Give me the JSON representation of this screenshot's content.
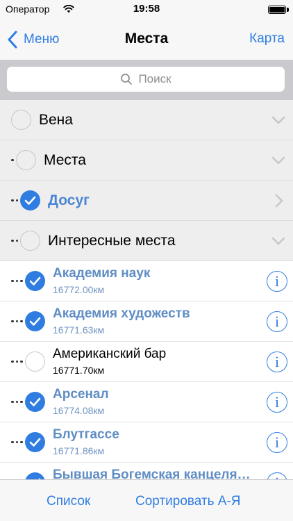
{
  "status_bar": {
    "carrier": "Оператор",
    "time": "19:58"
  },
  "nav": {
    "back_label": "Меню",
    "title": "Места",
    "right_label": "Карта"
  },
  "search": {
    "placeholder": "Поиск"
  },
  "groups": [
    {
      "label": "Вена",
      "level": 0,
      "checked": false,
      "expanded": true
    },
    {
      "label": "Места",
      "level": 1,
      "checked": false,
      "expanded": true
    },
    {
      "label": "Досуг",
      "level": 2,
      "checked": true,
      "expanded": false
    },
    {
      "label": "Интересные места",
      "level": 2,
      "checked": false,
      "expanded": true
    }
  ],
  "items": [
    {
      "title": "Академия наук",
      "distance": "16772.00км",
      "checked": true
    },
    {
      "title": "Академия художеств",
      "distance": "16771.63км",
      "checked": true
    },
    {
      "title": "Американский бар",
      "distance": "16771.70км",
      "checked": false
    },
    {
      "title": "Арсенал",
      "distance": "16774.08км",
      "checked": true
    },
    {
      "title": "Блутгассе",
      "distance": "16771.86км",
      "checked": true
    },
    {
      "title": "Бывшая Богемская канцеля…",
      "distance": "",
      "checked": true
    }
  ],
  "toolbar": {
    "list_label": "Список",
    "sort_label": "Сортировать А-Я"
  },
  "colors": {
    "accent": "#2f7de1",
    "selected_text": "#5f8dc4",
    "group_bg": "#eeeeef",
    "search_bg": "#c9c9ce"
  }
}
